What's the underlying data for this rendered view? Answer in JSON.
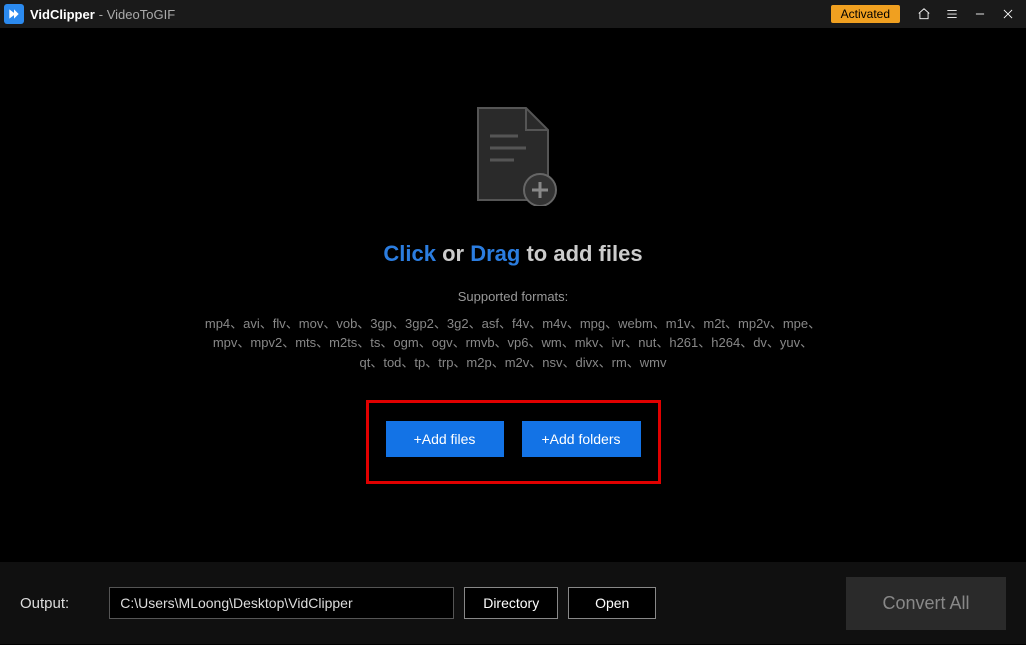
{
  "titlebar": {
    "app_name": "VidClipper",
    "sub_name": " - VideoToGIF",
    "activated": "Activated"
  },
  "main": {
    "click": "Click",
    "or": " or ",
    "drag": "Drag",
    "rest": " to add files",
    "supported_label": "Supported formats:",
    "formats": "mp4、avi、flv、mov、vob、3gp、3gp2、3g2、asf、f4v、m4v、mpg、webm、m1v、m2t、mp2v、mpe、mpv、mpv2、mts、m2ts、ts、ogm、ogv、rmvb、vp6、wm、mkv、ivr、nut、h261、h264、dv、yuv、qt、tod、tp、trp、m2p、m2v、nsv、divx、rm、wmv",
    "add_files": "+Add files",
    "add_folders": "+Add folders"
  },
  "footer": {
    "output_label": "Output:",
    "output_path": "C:\\Users\\MLoong\\Desktop\\VidClipper",
    "directory": "Directory",
    "open": "Open",
    "convert": "Convert All"
  }
}
